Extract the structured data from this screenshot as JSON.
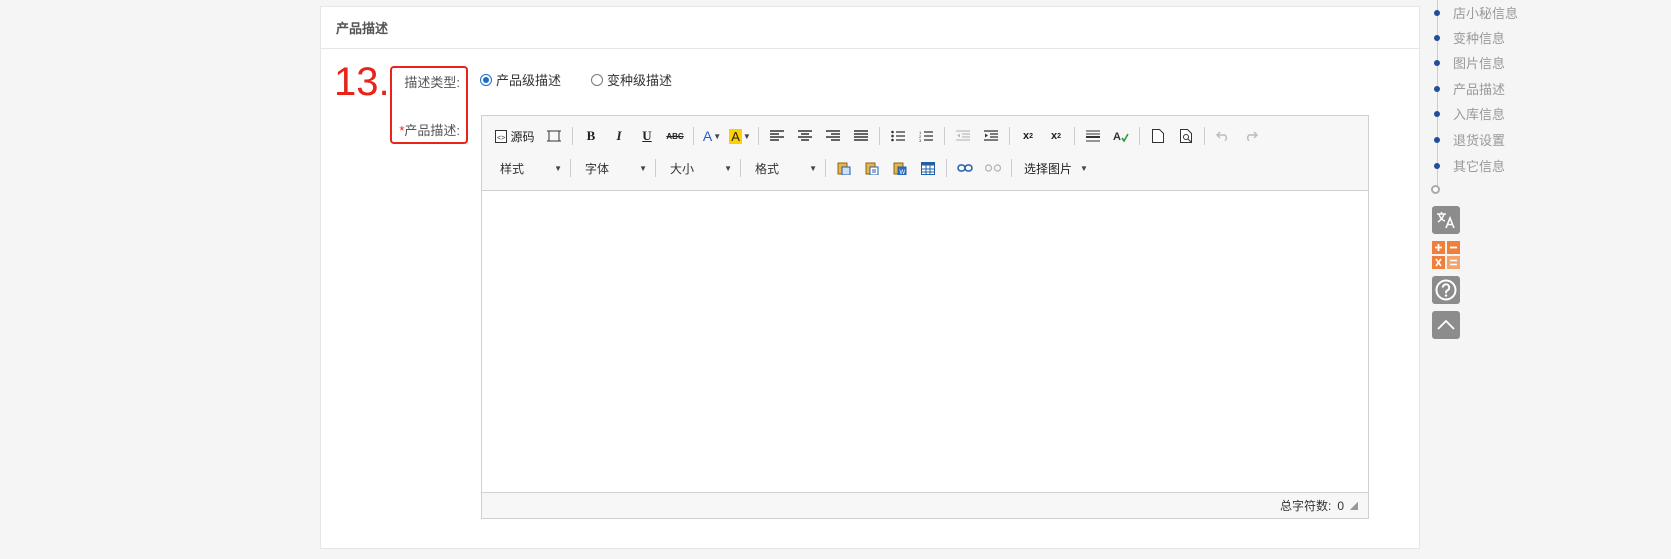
{
  "panel": {
    "title": "产品描述"
  },
  "annotation": {
    "number": "13."
  },
  "form": {
    "desc_type_label": "描述类型:",
    "desc_label_required": "*",
    "desc_label": "产品描述:",
    "radio_product": "产品级描述",
    "radio_variant": "变种级描述",
    "selected": "产品级描述"
  },
  "editor": {
    "source_label": "源码",
    "style_combo": "样式",
    "font_combo": "字体",
    "size_combo": "大小",
    "format_combo": "格式",
    "select_image": "选择图片",
    "char_count_label": "总字符数:",
    "char_count": "0"
  },
  "sidenav": {
    "items": [
      "店小秘信息",
      "变种信息",
      "图片信息",
      "产品描述",
      "入库信息",
      "退货设置",
      "其它信息"
    ]
  },
  "colors": {
    "accent": "#1a6fc9",
    "annotation": "#e8231a",
    "nav_bullet": "#1f4f9a",
    "calc_orange": "#f07f3c"
  }
}
